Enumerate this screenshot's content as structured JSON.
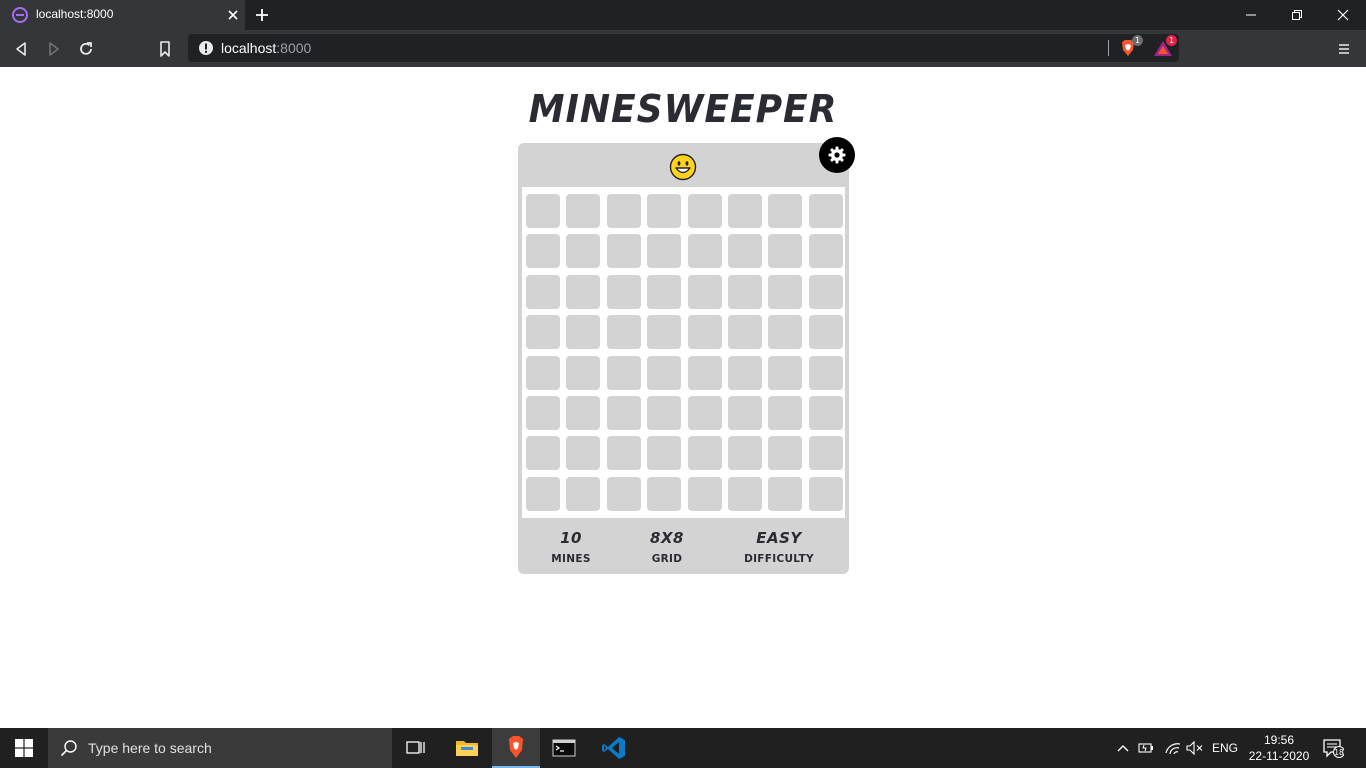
{
  "browser": {
    "tab_title": "localhost:8000",
    "url_host": "localhost",
    "url_port": ":8000",
    "shield_count": "1",
    "rewards_count": "1"
  },
  "game": {
    "title": "MINESWEEPER",
    "face": "smiley-face-icon",
    "rows": 8,
    "cols": 8,
    "stats": [
      {
        "value": "10",
        "label": "MINES"
      },
      {
        "value": "8X8",
        "label": "GRID"
      },
      {
        "value": "EASY",
        "label": "DIFFICULTY"
      }
    ]
  },
  "taskbar": {
    "search_placeholder": "Type here to search",
    "language": "ENG",
    "time": "19:56",
    "date": "22-11-2020",
    "notifications": "18"
  },
  "colors": {
    "board": "#d3d3d3",
    "title": "#2b2b33",
    "chrome_dark": "#202124",
    "chrome_toolbar": "#35363a",
    "taskbar": "#202020"
  }
}
